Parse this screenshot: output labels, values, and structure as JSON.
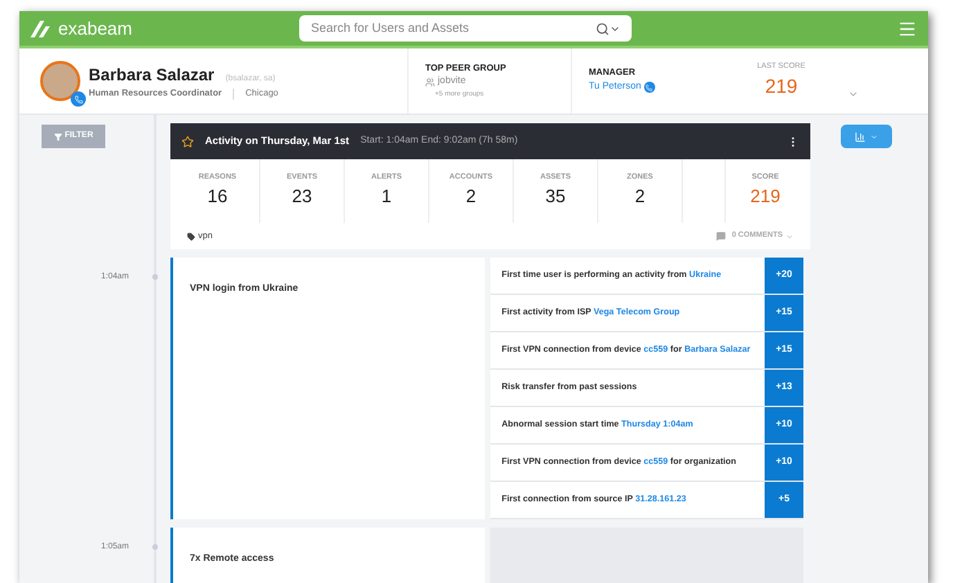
{
  "header": {
    "logo": "exabeam",
    "search": {
      "placeholder": "Search for Users and Assets"
    }
  },
  "profile": {
    "name": "Barbara Salazar",
    "handle": "(bsalazar, sa)",
    "title": "Human Resources Coordinator",
    "location": "Chicago",
    "peer_group": {
      "label": "TOP PEER GROUP",
      "value": "jobvite",
      "more": "+5 more groups"
    },
    "manager": {
      "label": "MANAGER",
      "value": "Tu Peterson"
    },
    "last_score": {
      "label": "LAST SCORE",
      "value": "219"
    }
  },
  "filter_button": "FILTER",
  "activity": {
    "title": "Activity on Thursday, Mar 1st",
    "range": "Start: 1:04am End: 9:02am (7h 58m)",
    "starred": false,
    "stats": [
      {
        "label": "REASONS",
        "value": "16",
        "kind": "plain"
      },
      {
        "label": "EVENTS",
        "value": "23",
        "kind": "plain"
      },
      {
        "label": "ALERTS",
        "value": "1",
        "kind": "plain"
      },
      {
        "label": "ACCOUNTS",
        "value": "2",
        "kind": "plain"
      },
      {
        "label": "ASSETS",
        "value": "35",
        "kind": "plain"
      },
      {
        "label": "ZONES",
        "value": "2",
        "kind": "plain"
      },
      {
        "label": "SCORE",
        "value": "219",
        "kind": "score"
      }
    ],
    "tag": "vpn",
    "comments": "0 COMMENTS"
  },
  "events": [
    {
      "time": "1:04am",
      "title": "VPN login from Ukraine",
      "reasons": [
        {
          "parts": [
            {
              "text": "First time user is performing an activity from "
            },
            {
              "text": "Ukraine",
              "link": true
            }
          ],
          "score": "+20"
        },
        {
          "parts": [
            {
              "text": "First activity from ISP "
            },
            {
              "text": "Vega Telecom Group",
              "link": true
            }
          ],
          "score": "+15"
        },
        {
          "parts": [
            {
              "text": "First VPN connection from device "
            },
            {
              "text": "cc559",
              "link": true
            },
            {
              "text": " for "
            },
            {
              "text": "Barbara Salazar",
              "link": true
            }
          ],
          "score": "+15"
        },
        {
          "parts": [
            {
              "text": "Risk transfer from past sessions"
            }
          ],
          "score": "+13"
        },
        {
          "parts": [
            {
              "text": "Abnormal session start time "
            },
            {
              "text": "Thursday 1:04am",
              "link": true
            }
          ],
          "score": "+10"
        },
        {
          "parts": [
            {
              "text": "First VPN connection from device "
            },
            {
              "text": "cc559",
              "link": true
            },
            {
              "text": " for organization"
            }
          ],
          "score": "+10"
        },
        {
          "parts": [
            {
              "text": "First connection from source IP "
            },
            {
              "text": "31.28.161.23",
              "link": true
            }
          ],
          "score": "+5"
        }
      ]
    },
    {
      "time": "1:05am",
      "title": "7x Remote access"
    }
  ]
}
